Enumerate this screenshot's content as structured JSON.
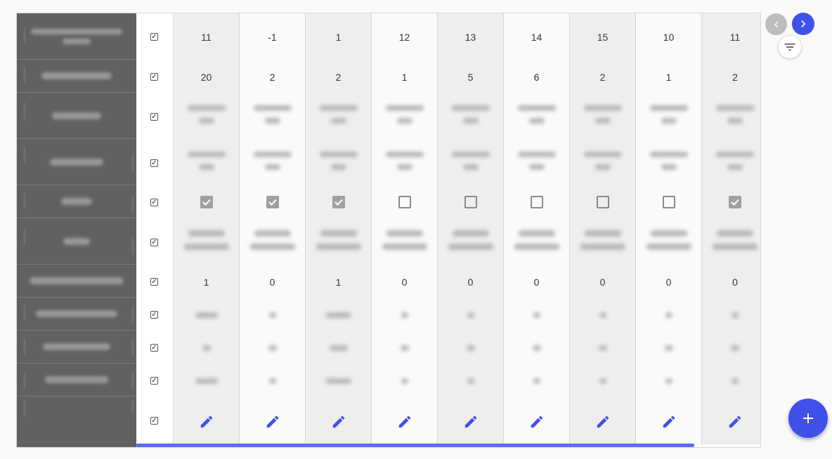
{
  "colors": {
    "accent": "#3f51e8",
    "sidebar": "#616161",
    "shade": "#eeeeee"
  },
  "row_checks": [
    "checked",
    "checked",
    "checked",
    "checked",
    "checked",
    "checked",
    "checked",
    "checked",
    "checked",
    "checked",
    "checked"
  ],
  "columns": [
    {
      "row1": "11",
      "row2": "20",
      "checkbox_checked": true,
      "count": "1",
      "edit_icon": "pencil-icon"
    },
    {
      "row1": "-1",
      "row2": "2",
      "checkbox_checked": true,
      "count": "0",
      "edit_icon": "pencil-icon"
    },
    {
      "row1": "1",
      "row2": "2",
      "checkbox_checked": true,
      "count": "1",
      "edit_icon": "pencil-icon"
    },
    {
      "row1": "12",
      "row2": "1",
      "checkbox_checked": false,
      "count": "0",
      "edit_icon": "pencil-icon"
    },
    {
      "row1": "13",
      "row2": "5",
      "checkbox_checked": false,
      "count": "0",
      "edit_icon": "pencil-icon"
    },
    {
      "row1": "14",
      "row2": "6",
      "checkbox_checked": false,
      "count": "0",
      "edit_icon": "pencil-icon"
    },
    {
      "row1": "15",
      "row2": "2",
      "checkbox_checked": false,
      "count": "0",
      "edit_icon": "pencil-icon"
    },
    {
      "row1": "10",
      "row2": "1",
      "checkbox_checked": false,
      "count": "0",
      "edit_icon": "pencil-icon"
    },
    {
      "row1": "11",
      "row2": "2",
      "checkbox_checked": true,
      "count": "0",
      "edit_icon": "pencil-icon"
    }
  ],
  "icons": {
    "prev": "chevron-left-icon",
    "next": "chevron-right-icon",
    "filter": "filter-icon",
    "add": "plus-icon"
  }
}
